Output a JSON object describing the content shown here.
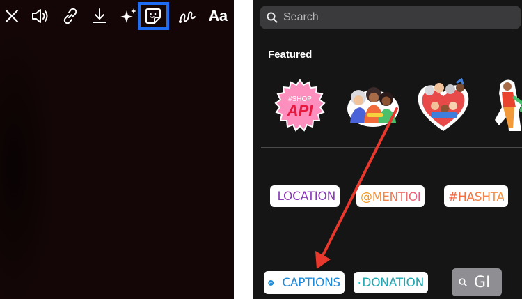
{
  "left_panel": {
    "toolbar": {
      "close_icon": "close-icon",
      "sound_icon": "sound-icon",
      "link_icon": "link-icon",
      "download_icon": "download-icon",
      "effects_icon": "sparkles-icon",
      "sticker_icon": "sticker-icon",
      "draw_icon": "draw-icon",
      "text_label": "Aa",
      "highlight_color": "#1f6df2"
    }
  },
  "right_panel": {
    "search": {
      "placeholder": "Search"
    },
    "section_title": "Featured",
    "featured_stickers": [
      {
        "name": "shop-api-sticker",
        "hashtag": "#SHOP",
        "text": "API"
      },
      {
        "name": "people-group-sticker"
      },
      {
        "name": "heart-family-sticker"
      },
      {
        "name": "dancing-people-sticker"
      }
    ],
    "chips": {
      "location": "LOCATION",
      "mention": "@MENTION",
      "hashtag": "#HASHTAG",
      "captions": "CAPTIONS",
      "captions_badge": "CC",
      "donation": "DONATION",
      "gif": "GI"
    },
    "colors": {
      "location": "#8a3ab9",
      "mention_start": "#f7a21b",
      "mention_end": "#e9528f",
      "hashtag_start": "#f2613f",
      "hashtag_end": "#f5a04a",
      "captions": "#1c8ad8",
      "donation": "#20a9b0",
      "arrow": "#e8372c"
    }
  }
}
